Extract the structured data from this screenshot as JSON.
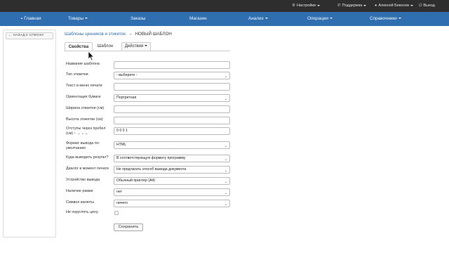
{
  "topbar": {
    "settings": "Настройки",
    "support": "Поддержка",
    "user": "Алексей Бекосев",
    "logout": "Выход"
  },
  "nav": {
    "home": "Главная",
    "goods": "Товары",
    "orders": "Заказы",
    "shop": "Магазин",
    "analysis": "Анализ",
    "operations": "Операции",
    "references": "Справочники"
  },
  "sidebar": {
    "back_label": "← НАЗАД К СПИСКУ"
  },
  "breadcrumb": {
    "parent": "Шаблоны ценников и этикеток",
    "arrow": "→",
    "current": "НОВЫЙ ШАБЛОН"
  },
  "tabs": {
    "properties": "Свойства",
    "template": "Шаблон",
    "actions": "Действия"
  },
  "form": {
    "template_name": {
      "label": "Название шаблона",
      "value": ""
    },
    "label_type": {
      "label": "Тип этикетки",
      "value": "- выберите -"
    },
    "print_menu_text": {
      "label": "Текст в меню печати",
      "value": ""
    },
    "paper_orientation": {
      "label": "Ориентация бумаги",
      "value": "Портретная"
    },
    "label_width": {
      "label": "Ширина этикетки (см)",
      "value": ""
    },
    "label_height": {
      "label": "Высота этикетки (см)",
      "value": ""
    },
    "margins": {
      "label": "Отступы через пробел (см) ↑ → ↓ ←",
      "value": "0 0 0 1"
    },
    "output_format": {
      "label": "Формат вывода по-умолчанию",
      "value": "HTML"
    },
    "output_target": {
      "label": "Куда выводить результ?",
      "value": "В соответствующую формату программу"
    },
    "print_dialog": {
      "label": "Диалог в момент печати",
      "value": "Не предлагать способ вывода документа"
    },
    "output_device": {
      "label": "Устройство вывода",
      "value": "Обычный принтер (A4)"
    },
    "frame": {
      "label": "Наличие рамки",
      "value": "нет"
    },
    "currency_symbol": {
      "label": "Символ валюты",
      "value": "ничего"
    },
    "no_round": {
      "label": "Не округлять цену",
      "checked": false
    }
  },
  "save_label": "Сохранить",
  "colors": {
    "topbar_bg": "#2e2e2e",
    "nav_bg": "#2f6fb0",
    "link": "#2f6fb0"
  }
}
